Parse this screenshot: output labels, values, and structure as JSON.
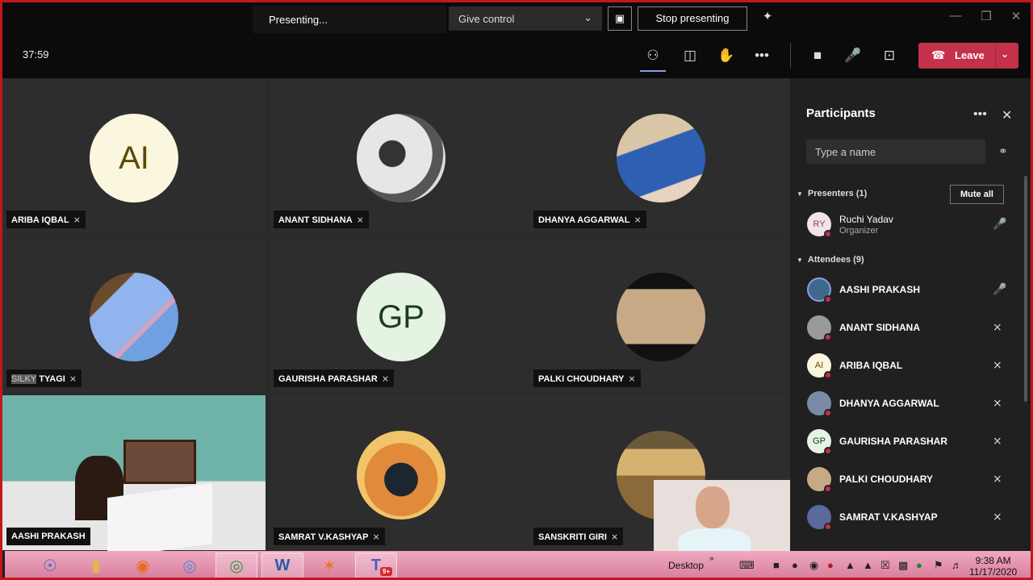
{
  "share_bar": {
    "status": "Presenting...",
    "give_control": "Give control",
    "stop_presenting": "Stop presenting"
  },
  "toolbar": {
    "timer": "37:59",
    "leave_label": "Leave"
  },
  "tiles": [
    {
      "name": "ARIBA IQBAL",
      "initials": "AI",
      "avatar_bg": "#fbf7de",
      "initials_color": "#5c4a05"
    },
    {
      "name": "ANANT SIDHANA",
      "initials": "",
      "avatar_bg": "#cfcfcf"
    },
    {
      "name": "DHANYA AGGARWAL",
      "initials": "",
      "avatar_bg": "#7aa0c8"
    },
    {
      "name_hl": "SILKY",
      "name": " TYAGI",
      "initials": "",
      "avatar_bg": "#6fa0e0"
    },
    {
      "name": "GAURISHA PARASHAR",
      "initials": "GP",
      "avatar_bg": "#e4f3e2",
      "initials_color": "#1d3b1d"
    },
    {
      "name": "PALKI CHOUDHARY",
      "initials": "",
      "avatar_bg": "#c7a985"
    },
    {
      "name": "AASHI PRAKASH",
      "initials": "",
      "avatar_bg": "#9cc9c1"
    },
    {
      "name": "SAMRAT V.KASHYAP",
      "initials": "",
      "avatar_bg": "#d06a2e"
    },
    {
      "name": "SANSKRITI GIRI",
      "initials": "",
      "avatar_bg": "#b79056"
    }
  ],
  "participants": {
    "title": "Participants",
    "search_placeholder": "Type a name",
    "presenters_label": "Presenters (1)",
    "mute_all": "Mute all",
    "attendees_label": "Attendees (9)",
    "presenters": [
      {
        "name": "Ruchi Yadav",
        "role": "Organizer",
        "initials": "RY"
      }
    ],
    "attendees": [
      {
        "name": "AASHI PRAKASH",
        "initials": "",
        "avatar_bg": "#3f6a8c",
        "mic": "on"
      },
      {
        "name": "ANANT SIDHANA",
        "initials": "",
        "avatar_bg": "#9a9a9a",
        "mic": "off"
      },
      {
        "name": "ARIBA IQBAL",
        "initials": "AI",
        "avatar_bg": "#fbf7de",
        "mic": "off"
      },
      {
        "name": "DHANYA AGGARWAL",
        "initials": "",
        "avatar_bg": "#7b8aa8",
        "mic": "off"
      },
      {
        "name": "GAURISHA PARASHAR",
        "initials": "GP",
        "avatar_bg": "#e4f3e2",
        "mic": "off"
      },
      {
        "name": "PALKI CHOUDHARY",
        "initials": "",
        "avatar_bg": "#c7a985",
        "mic": "off"
      },
      {
        "name": "SAMRAT V.KASHYAP",
        "initials": "",
        "avatar_bg": "#5a6a9a",
        "mic": "off"
      }
    ]
  },
  "taskbar": {
    "desktop_label": "Desktop",
    "teams_badge": "9+",
    "time": "9:38 AM",
    "date": "11/17/2020"
  },
  "colors": {
    "leave": "#c4314b",
    "frame": "#c4161c",
    "taskbar": "#e89ab5"
  }
}
